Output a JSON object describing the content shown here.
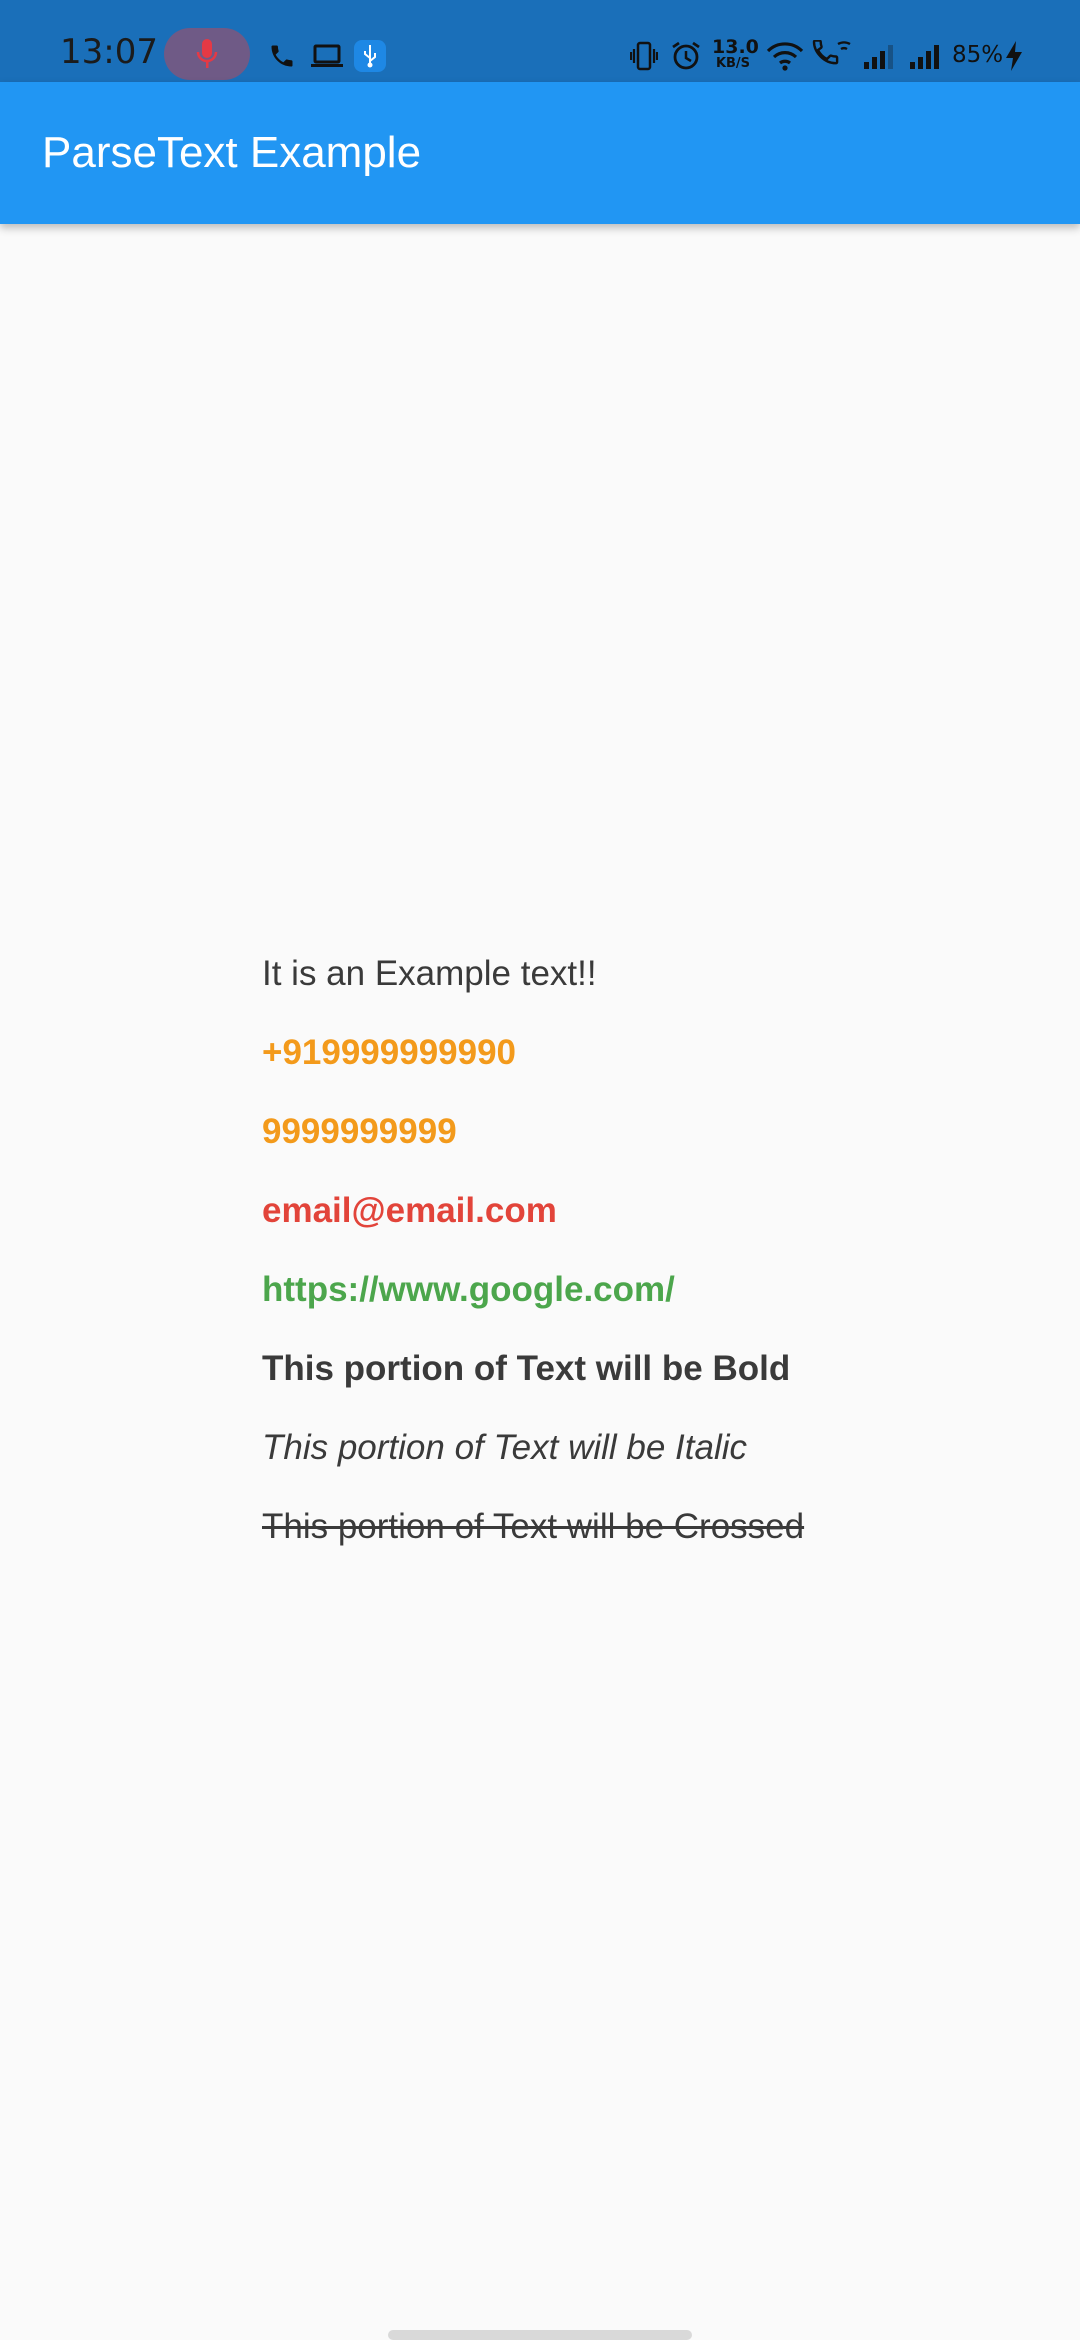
{
  "status_bar": {
    "time": "13:07",
    "network_speed_value": "13.0",
    "network_speed_unit": "KB/S",
    "battery": "85%",
    "icons": [
      "mic-icon",
      "phone-icon",
      "laptop-icon",
      "usb-icon",
      "vibrate-icon",
      "alarm-icon",
      "wifi-icon",
      "wifi-calling-icon",
      "signal-icon",
      "signal-icon",
      "charging-icon"
    ]
  },
  "app_bar": {
    "title": "ParseText Example",
    "color": "#2196f3"
  },
  "content": {
    "lines": [
      {
        "text": "It is an Example text!!",
        "style": "normal",
        "color": "#3a3a3a"
      },
      {
        "text": "+919999999990",
        "style": "bold",
        "color": "#f39a1b"
      },
      {
        "text": "9999999999",
        "style": "bold",
        "color": "#f39a1b"
      },
      {
        "text": "email@email.com",
        "style": "bold",
        "color": "#e2443a"
      },
      {
        "text": "https://www.google.com/",
        "style": "bold",
        "color": "#4ca64c"
      },
      {
        "text": "This portion of Text will be Bold",
        "style": "bold",
        "color": "#3a3a3a"
      },
      {
        "text": "This portion of Text will be Italic",
        "style": "italic",
        "color": "#3a3a3a"
      },
      {
        "text": "This portion of Text will be Crossed",
        "style": "strike",
        "color": "#3a3a3a"
      }
    ]
  }
}
